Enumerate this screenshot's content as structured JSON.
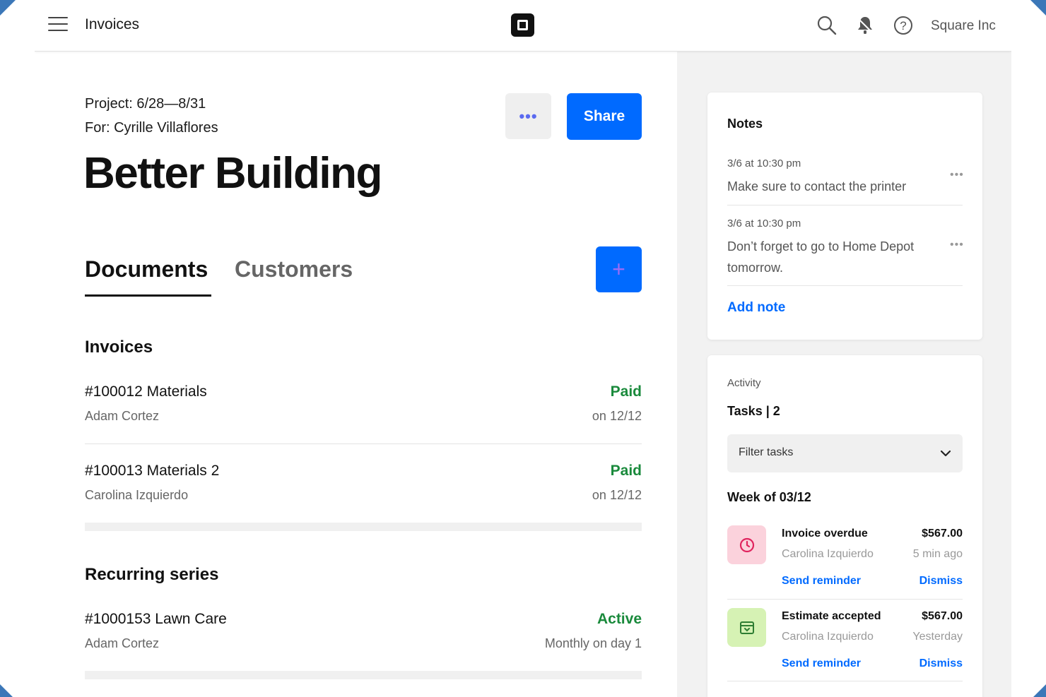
{
  "header": {
    "title": "Invoices",
    "account": "Square Inc",
    "icons": [
      "menu-icon",
      "square-logo",
      "search-icon",
      "notification-icon",
      "help-icon"
    ]
  },
  "project": {
    "dates": "Project: 6/28—8/31",
    "client": "For: Cyrille Villaflores",
    "title": "Better Building",
    "more_label": "•••",
    "share_label": "Share"
  },
  "tabs": [
    {
      "label": "Documents",
      "active": true
    },
    {
      "label": "Customers",
      "active": false
    }
  ],
  "add_label": "+",
  "invoices": {
    "title": "Invoices",
    "items": [
      {
        "title": "#100012 Materials",
        "customer": "Adam Cortez",
        "status": "Paid",
        "date": "on 12/12"
      },
      {
        "title": "#100013 Materials 2",
        "customer": "Carolina Izquierdo",
        "status": "Paid",
        "date": "on 12/12"
      }
    ]
  },
  "recurring": {
    "title": "Recurring series",
    "items": [
      {
        "title": "#1000153 Lawn Care",
        "customer": "Adam Cortez",
        "status": "Active",
        "date": "Monthly on day 1"
      }
    ]
  },
  "notes": {
    "title": "Notes",
    "items": [
      {
        "time": "3/6 at 10:30 pm",
        "text": "Make sure to contact the printer"
      },
      {
        "time": "3/6 at 10:30 pm",
        "text": "Don’t forget to go to Home Depot tomorrow."
      }
    ],
    "more_label": "•••",
    "add_label": "Add note"
  },
  "activity": {
    "label": "Activity",
    "tasks_title": "Tasks | 2",
    "filter_placeholder": "Filter tasks",
    "week_title": "Week of 03/12",
    "tasks": [
      {
        "title": "Invoice overdue",
        "amount": "$567.00",
        "customer": "Carolina Izquierdo",
        "time": "5 min ago",
        "reminder": "Send reminder",
        "dismiss": "Dismiss",
        "icon": "clock-icon",
        "color": "#fbd2dc"
      },
      {
        "title": "Estimate accepted",
        "amount": "$567.00",
        "customer": "Carolina Izquierdo",
        "time": "Yesterday",
        "reminder": "Send reminder",
        "dismiss": "Dismiss",
        "icon": "archive-icon",
        "color": "#d6f2b4"
      }
    ]
  },
  "colors": {
    "primary": "#006aff",
    "success": "#1a8a3c",
    "panel": "#f2f2f2"
  }
}
